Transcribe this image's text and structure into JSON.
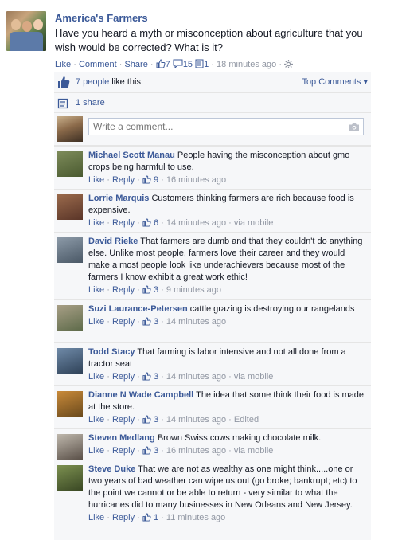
{
  "post": {
    "page_name": "America's Farmers",
    "text": "Have you heard a myth or misconception about agriculture that you wish would be corrected? What is it?",
    "actions": {
      "like": "Like",
      "comment": "Comment",
      "share": "Share",
      "likes_count": "7",
      "comments_count": "15",
      "shares_count": "1",
      "timestamp": "18 minutes ago",
      "separator": "·"
    }
  },
  "ufi": {
    "likes_text_link": "7 people",
    "likes_text_rest": " like this.",
    "top_comments": "Top Comments ▾",
    "shares_text": "1 share",
    "compose_placeholder": "Write a comment..."
  },
  "comments": [
    {
      "author": "Michael Scott Manau",
      "text": "People having the misconception about gmo crops being harmful to use.",
      "likes": "9",
      "time": "16 minutes ago",
      "extra": ""
    },
    {
      "author": "Lorrie Marquis",
      "text": "Customers thinking farmers are rich because food is expensive.",
      "likes": "6",
      "time": "14 minutes ago",
      "extra": "via mobile"
    },
    {
      "author": "David Rieke",
      "text": "That farmers are dumb and that they couldn't do anything else. Unlike most people, farmers love their career and they would make a most people look like underachievers because most of the farmers I know exhibit a great work ethic!",
      "likes": "3",
      "time": "9 minutes ago",
      "extra": ""
    },
    {
      "author": "Suzi Laurance-Petersen",
      "text": "cattle grazing is destroying our rangelands",
      "likes": "3",
      "time": "14 minutes ago",
      "extra": ""
    },
    {
      "author": "Todd Stacy",
      "text": "That farming is labor intensive and not all done from a tractor seat",
      "likes": "3",
      "time": "14 minutes ago",
      "extra": "via mobile"
    },
    {
      "author": "Dianne N Wade Campbell",
      "text": "The idea that some think their food is made at the store.",
      "likes": "3",
      "time": "14 minutes ago",
      "extra": "Edited"
    },
    {
      "author": "Steven Medlang",
      "text": "Brown Swiss cows making chocolate milk.",
      "likes": "3",
      "time": "16 minutes ago",
      "extra": "via mobile"
    },
    {
      "author": "Steve Duke",
      "text": "That we are not as wealthy as one might think.....one or two years of bad weather can wipe us out (go broke; bankrupt; etc) to the point we cannot or be able to return - very similar to what the hurricanes did to many businesses in New Orleans and New Jersey.",
      "likes": "1",
      "time": "11 minutes ago",
      "extra": ""
    }
  ],
  "comment_actions": {
    "like": "Like",
    "reply": "Reply",
    "separator": "·"
  },
  "colors": {
    "link": "#3b5998",
    "meta": "#9197a3",
    "ufi_bg": "#f6f7f9"
  }
}
